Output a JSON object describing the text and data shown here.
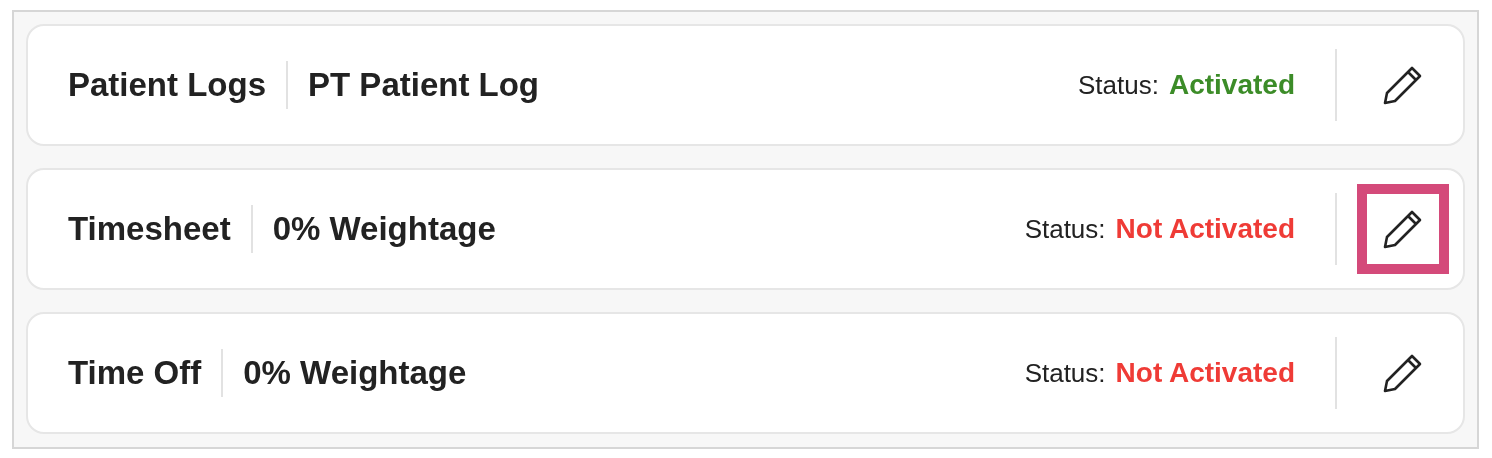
{
  "rows": [
    {
      "name": "Patient Logs",
      "detail": "PT Patient Log",
      "status_label": "Status:",
      "status": "Activated",
      "activated": true,
      "highlighted": false
    },
    {
      "name": "Timesheet",
      "detail": "0% Weightage",
      "status_label": "Status:",
      "status": "Not Activated",
      "activated": false,
      "highlighted": true
    },
    {
      "name": "Time Off",
      "detail": "0% Weightage",
      "status_label": "Status:",
      "status": "Not Activated",
      "activated": false,
      "highlighted": false
    }
  ]
}
